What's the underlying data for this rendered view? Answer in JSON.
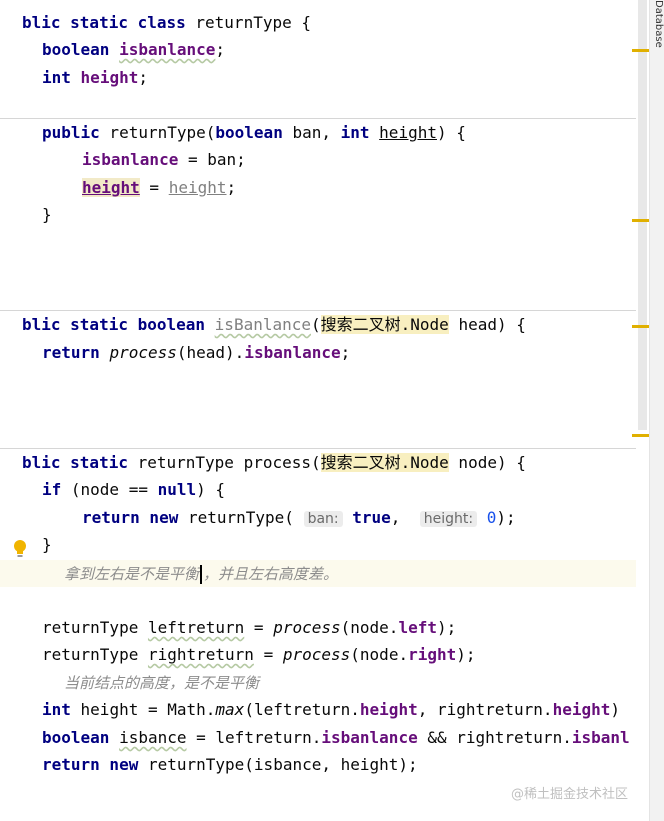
{
  "colors": {
    "keyword": "#000080",
    "field": "#660e7a",
    "number": "#1750eb",
    "comment": "#8c8c8c",
    "hint_bg": "#ececec",
    "current_line": "#fcfaed",
    "usage_highlight": "#f2eac8",
    "marker": "#e0b000"
  },
  "side_tab": "Database",
  "code": {
    "l1": {
      "kw": "blic static class",
      "name": " returnType {"
    },
    "l2": {
      "kw": "boolean",
      "field": "isbanlance",
      "end": ";"
    },
    "l3": {
      "kw": "int",
      "field": "height",
      "end": ";"
    },
    "l4": {
      "kw": "public",
      "name": " returnType(",
      "kw2": "boolean",
      "p1": " ban, ",
      "kw3": "int",
      "p2": "height",
      "end": ") {"
    },
    "l5": {
      "field": "isbanlance",
      "rest": " = ban;"
    },
    "l6": {
      "field": "height",
      "mid": " = ",
      "param": "height",
      "end": ";"
    },
    "l7": {
      "text": "}"
    },
    "l8": {
      "kw": "blic static boolean",
      "method": "isBanlance",
      "paren": "(",
      "type": "搜索二叉树.Node",
      "rest": " head) {"
    },
    "l9": {
      "kw": "return",
      "call": "process",
      "args": "(head).",
      "field": "isbanlance",
      "end": ";"
    },
    "l10": {
      "kw": "blic static",
      "name": " returnType process(",
      "type": "搜索二叉树.Node",
      "rest": " node) {"
    },
    "l11": {
      "kw": "if",
      "mid": " (node == ",
      "kw2": "null",
      "end": ") {"
    },
    "l12": {
      "kw": "return new",
      "name": " returnType(",
      "hint1": "ban:",
      "val1": "true",
      "sep": ", ",
      "hint2": "height:",
      "val2": "0",
      "end": ");"
    },
    "l13": {
      "text": "}"
    },
    "l14": {
      "comment_a": "拿到左右是不是平衡",
      "comment_b": "，并且左右高度差。"
    },
    "l15": {
      "type": "returnType",
      "var": "leftreturn",
      "mid": " = ",
      "call": "process",
      "args": "(node.",
      "field": "left",
      "end": ");"
    },
    "l16": {
      "type": "returnType",
      "var": "rightreturn",
      "mid": " = ",
      "call": "process",
      "args": "(node.",
      "field": "right",
      "end": ");"
    },
    "l17": {
      "comment": "当前结点的高度，是不是平衡"
    },
    "l18": {
      "kw": "int",
      "mid": " height = Math.",
      "call": "max",
      "args": "(leftreturn.",
      "field": "height",
      "sep": ", rightreturn.",
      "field2": "height",
      "end": ")"
    },
    "l19": {
      "kw": "boolean",
      "var": "isbance",
      "mid": " = leftreturn.",
      "field": "isbanlance",
      "amp": " && rightreturn.",
      "field2": "isbanl"
    },
    "l20": {
      "kw": "return new",
      "rest": " returnType(isbance, height);"
    }
  },
  "watermark": "@稀土掘金技术社区"
}
